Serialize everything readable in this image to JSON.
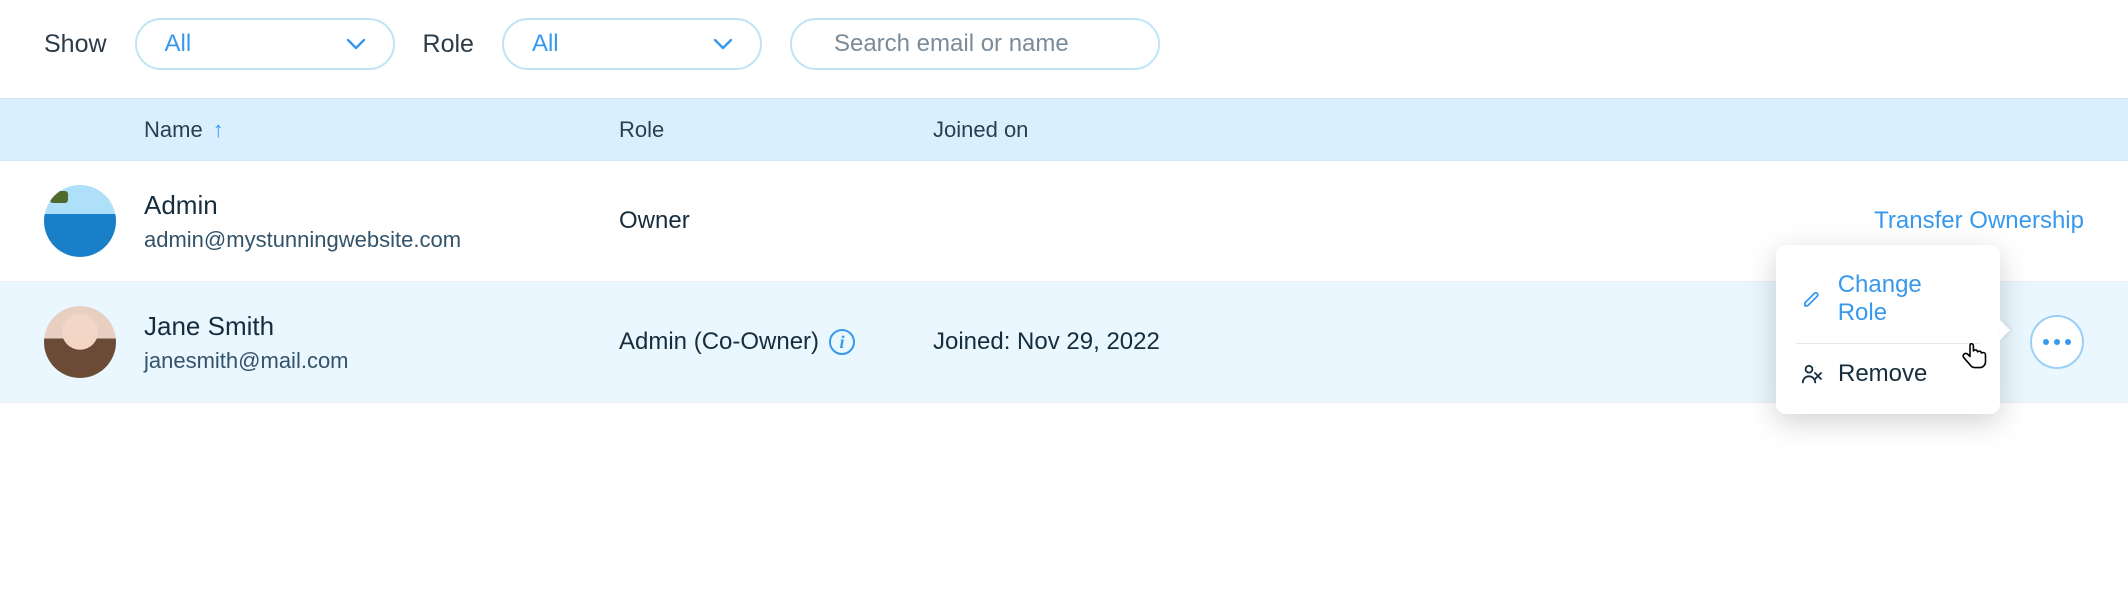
{
  "filters": {
    "show_label": "Show",
    "show_value": "All",
    "role_label": "Role",
    "role_value": "All",
    "search_placeholder": "Search email or name"
  },
  "columns": {
    "name": "Name",
    "role": "Role",
    "joined": "Joined on"
  },
  "rows": [
    {
      "name": "Admin",
      "email": "admin@mystunningwebsite.com",
      "role": "Owner",
      "joined": "",
      "action_link": "Transfer Ownership"
    },
    {
      "name": "Jane Smith",
      "email": "janesmith@mail.com",
      "role": "Admin (Co-Owner)",
      "joined": "Joined: Nov 29, 2022"
    }
  ],
  "popover": {
    "change_role": "Change Role",
    "remove": "Remove"
  },
  "colors": {
    "accent": "#3899ec",
    "header_bg": "#daeffe"
  }
}
